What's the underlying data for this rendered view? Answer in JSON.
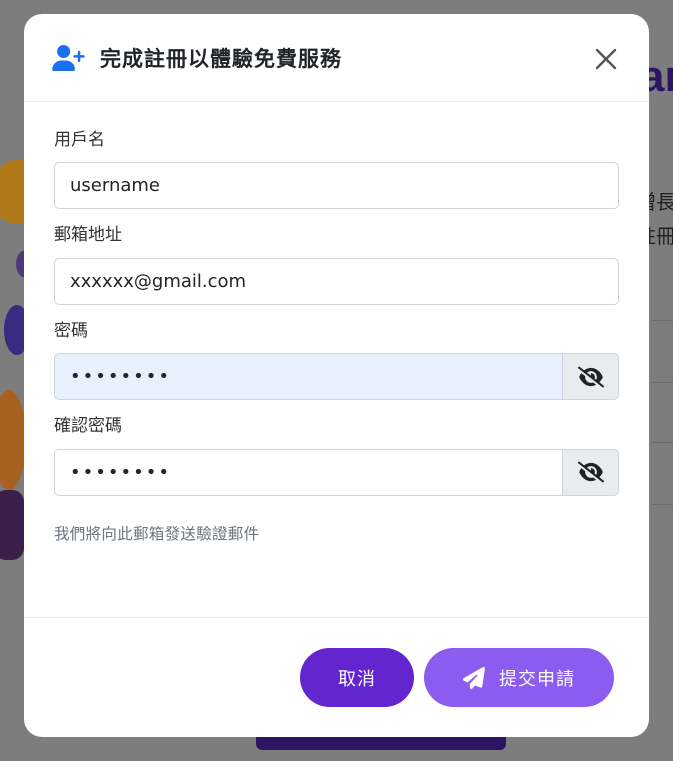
{
  "background": {
    "heading_fragment": "ar",
    "line1_fragment": "增長",
    "line2_fragment": "註冊"
  },
  "modal": {
    "title": "完成註冊以體驗免費服務",
    "header_icon": "user-plus-icon",
    "close_icon": "close-icon",
    "fields": {
      "username": {
        "label": "用戶名",
        "value": "username"
      },
      "email": {
        "label": "郵箱地址",
        "value": "xxxxxx@gmail.com"
      },
      "password": {
        "label": "密碼",
        "value": "••••••••",
        "toggle_icon": "eye-slash-icon"
      },
      "confirm_password": {
        "label": "確認密碼",
        "value": "••••••••",
        "toggle_icon": "eye-slash-icon"
      }
    },
    "help_text": "我們將向此郵箱發送驗證郵件",
    "buttons": {
      "cancel": "取消",
      "submit": "提交申請",
      "submit_icon": "paper-plane-icon"
    }
  },
  "colors": {
    "primary": "#6225d0",
    "submit": "#8c5cf0",
    "header_icon": "#1a6ff0",
    "autofill_bg": "#e8f0fe"
  }
}
